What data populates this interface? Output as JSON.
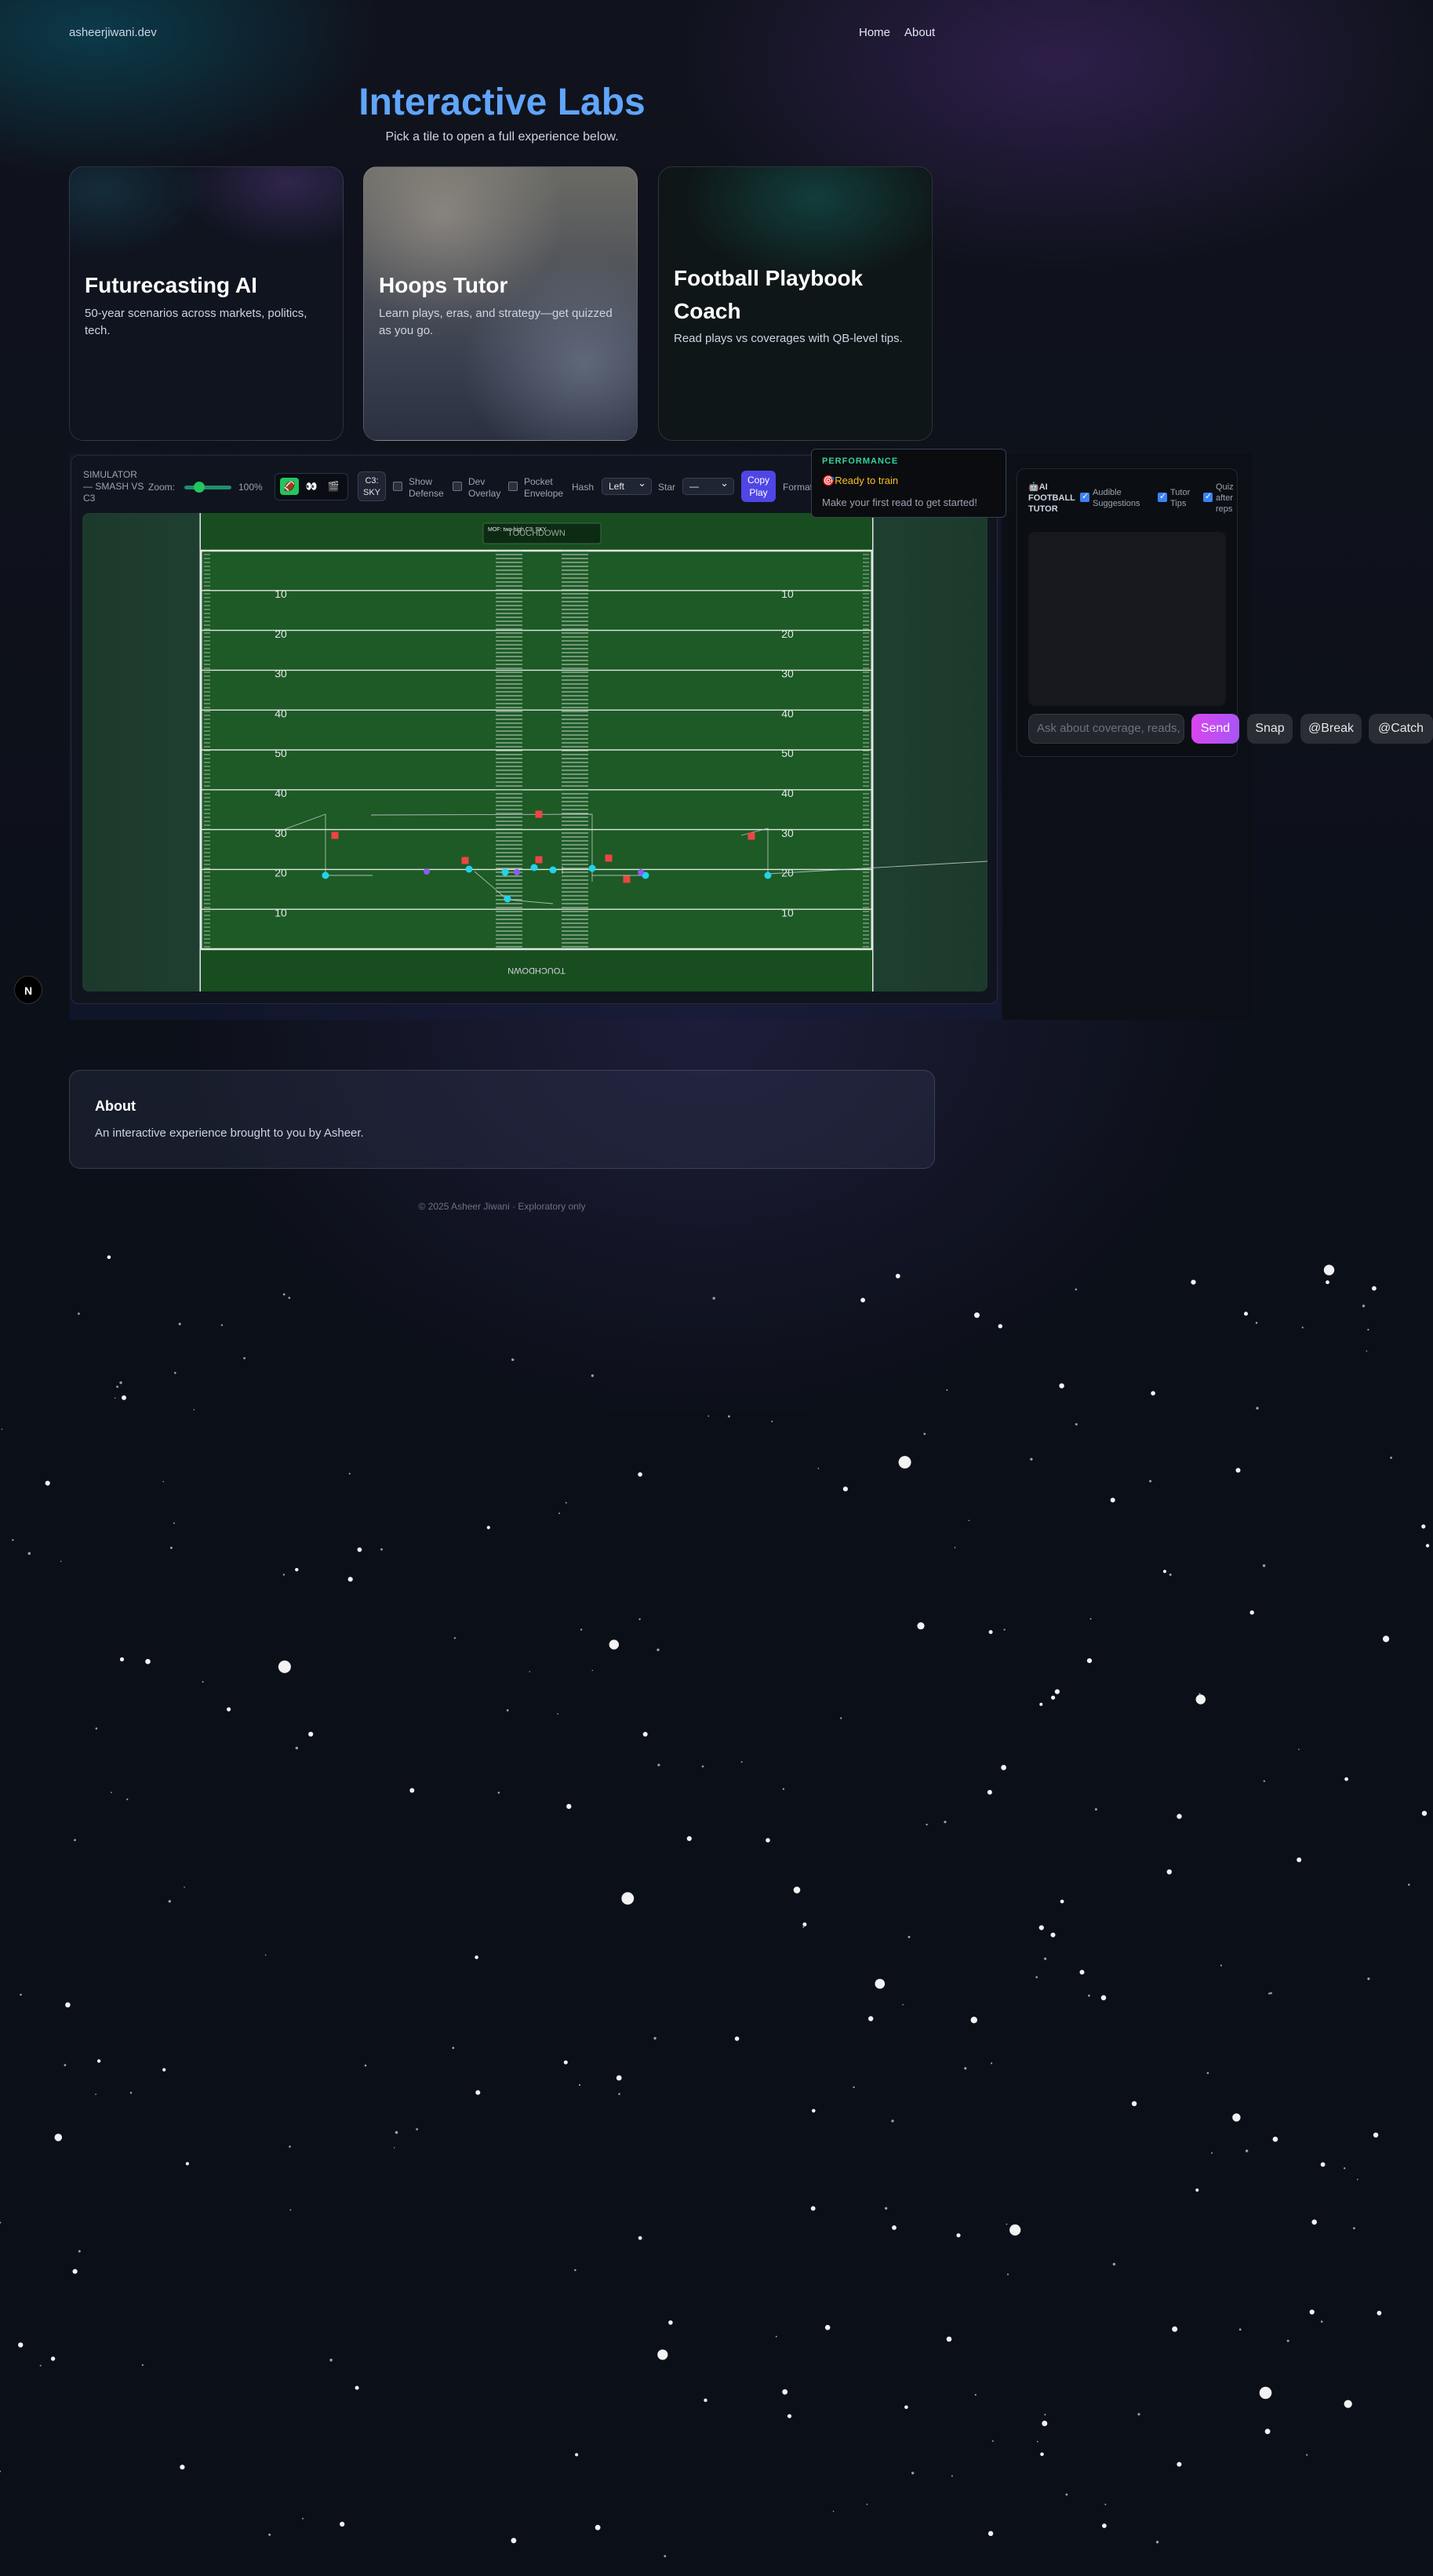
{
  "brand": "asheerjiwani.dev",
  "nav": {
    "home": "Home",
    "about": "About"
  },
  "hero": {
    "title": "Interactive Labs",
    "subtitle": "Pick a tile to open a full experience below."
  },
  "tiles": [
    {
      "title": "Futurecasting AI",
      "description": "50-year scenarios across markets, politics, tech."
    },
    {
      "title": "Hoops Tutor",
      "description": "Learn plays, eras, and strategy—get quizzed as you go."
    },
    {
      "title": "Football Playbook Coach",
      "description": "Read plays vs coverages with QB-level tips."
    }
  ],
  "simulator": {
    "label": "SIMULATOR — SMASH VS C3",
    "zoom_label": "Zoom:",
    "zoom_value": "100%",
    "zoom_level": 1.0,
    "view_buttons": [
      "field-icon",
      "eyes-icon",
      "film-icon"
    ],
    "coverage_button": "C3: SKY",
    "toggles": [
      {
        "label": "Show Defense",
        "checked": false
      },
      {
        "label": "Dev Overlay",
        "checked": false
      },
      {
        "label": "Pocket Envelope",
        "checked": false
      }
    ],
    "hash_label": "Hash",
    "hash_value": "Left",
    "star_label": "Star",
    "star_value": "—",
    "copy_button": "Copy Play",
    "format_label": "Format"
  },
  "performance": {
    "title": "PERFORMANCE",
    "status": "Ready to train",
    "status_icon": "target-icon",
    "hint": "Make your first read to get started!"
  },
  "field": {
    "endzone_top": "TOUCHDOWN",
    "endzone_bottom": "TOUCHDOWN",
    "info_box": "MOF: two-high C3: SKY",
    "yard_numbers": [
      "10",
      "20",
      "30",
      "40",
      "50",
      "40",
      "30",
      "20",
      "10"
    ],
    "colors": {
      "offense": "#22d3ee",
      "defense": "#ef4444",
      "turf": "#1d5a26"
    }
  },
  "tutor": {
    "title": "AI FOOTBALL TUTOR",
    "title_icon": "robot-icon",
    "options": [
      {
        "label": "Audible Suggestions",
        "checked": true
      },
      {
        "label": "Tutor Tips",
        "checked": true
      },
      {
        "label": "Quiz after reps",
        "checked": true
      }
    ],
    "input_placeholder": "Ask about coverage, reads, or leverage…",
    "send": "Send",
    "quick": [
      "Snap",
      "@Break",
      "@Catch"
    ]
  },
  "about": {
    "title": "About",
    "text": "An interactive experience brought to you by Asheer."
  },
  "footer": "© 2025 Asheer Jiwani · Exploratory only",
  "next_badge": "N"
}
